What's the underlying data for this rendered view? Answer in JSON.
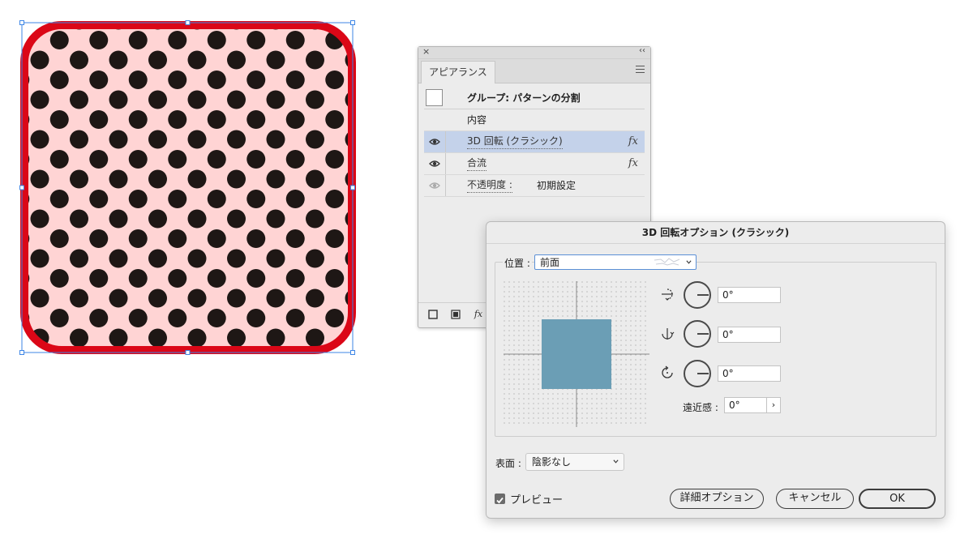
{
  "appearance_panel": {
    "tab_title": "アピアランス",
    "close_glyph": "×",
    "collapse_glyph": "‹‹",
    "rows": [
      {
        "label": "グループ: パターンの分割",
        "kind": "group"
      },
      {
        "label": "内容",
        "kind": "contents"
      },
      {
        "label": "3D 回転 (クラシック)",
        "fx": "fx",
        "selected": true
      },
      {
        "label": "合流",
        "fx": "fx"
      },
      {
        "label": "不透明度 :",
        "value": "初期設定"
      }
    ],
    "footer_fx": "fx"
  },
  "dialog": {
    "title": "3D 回転オプション (クラシック)",
    "position_label": "位置 :",
    "position_value": "前面",
    "x_rotation": "0°",
    "y_rotation": "0°",
    "z_rotation": "0°",
    "perspective_label": "遠近感 :",
    "perspective_value": "0°",
    "perspective_button": "›",
    "surface_label": "表面 :",
    "surface_value": "陰影なし",
    "preview_label": "プレビュー",
    "preview_checked": true,
    "buttons": {
      "more_options": "詳細オプション",
      "cancel": "キャンセル",
      "ok": "OK"
    }
  },
  "colors": {
    "artwork_fill": "#ffd4d4",
    "artwork_stroke": "#db0717",
    "polka_dots": "#1e1715",
    "selection": "#3d86e6",
    "cube_face": "#6b9eb5",
    "selected_row": "#c4d2ea"
  }
}
